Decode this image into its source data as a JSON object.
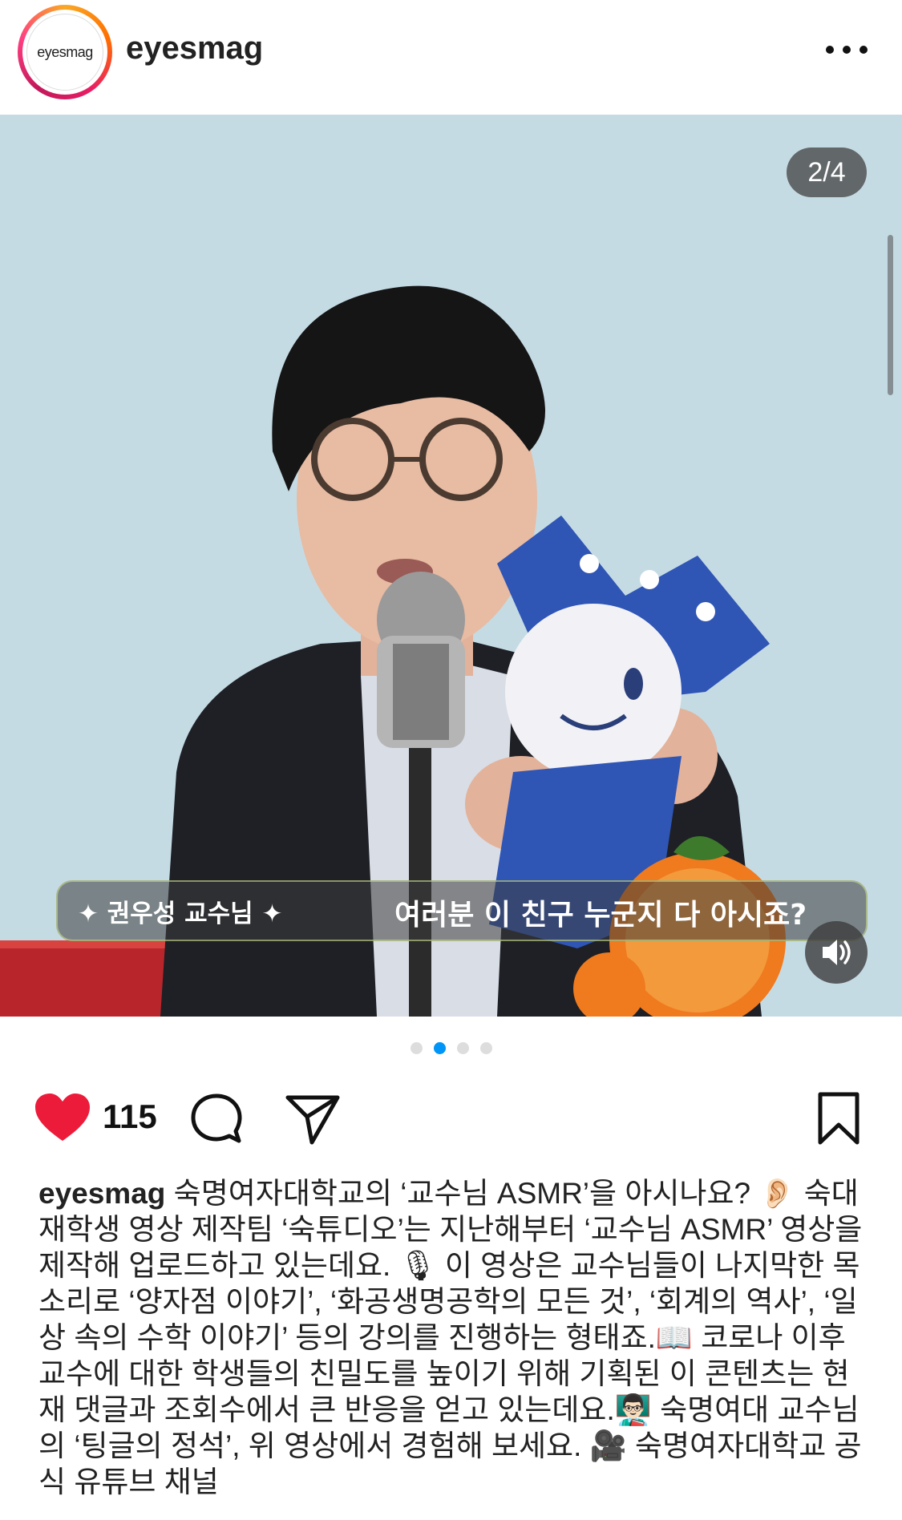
{
  "header": {
    "avatar_text": "eyesmag",
    "username": "eyesmag"
  },
  "media": {
    "counter": "2/4",
    "subtitle_name": "✦ 권우성 교수님 ✦",
    "subtitle_text": "여러분 이 친구 누군지 다 아시죠?",
    "pagination": {
      "total": 4,
      "active_index": 1
    }
  },
  "actions": {
    "like_count": "115"
  },
  "caption": {
    "username": "eyesmag",
    "text": "숙명여자대학교의 ‘교수님 ASMR’을 아시나요? 👂🏻 숙대 재학생 영상 제작팀 ‘숙튜디오’는 지난해부터 ‘교수님 ASMR’ 영상을 제작해 업로드하고 있는데요. 🎙 이 영상은 교수님들이 나지막한 목소리로 ‘양자점 이야기’, ‘화공생명공학의 모든 것’, ‘회계의 역사’, ‘일상 속의 수학 이야기’ 등의 강의를 진행하는 형태죠.📖 코로나 이후 교수에 대한 학생들의 친밀도를 높이기 위해 기획된 이 콘텐츠는 현재 댓글과 조회수에서 큰 반응을 얻고 있는데요.👨🏻‍🏫 숙명여대 교수님의 ‘팅글의 정석’, 위 영상에서 경험해 보세요. 🎥 숙명여자대학교 공식 유튜브 채널"
  },
  "colors": {
    "like_red": "#ed1b3a",
    "active_dot": "#0095f6",
    "background_photo": "#c8dde6"
  },
  "icons": [
    "more-icon",
    "volume-icon",
    "heart-icon",
    "comment-icon",
    "share-icon",
    "bookmark-icon"
  ]
}
